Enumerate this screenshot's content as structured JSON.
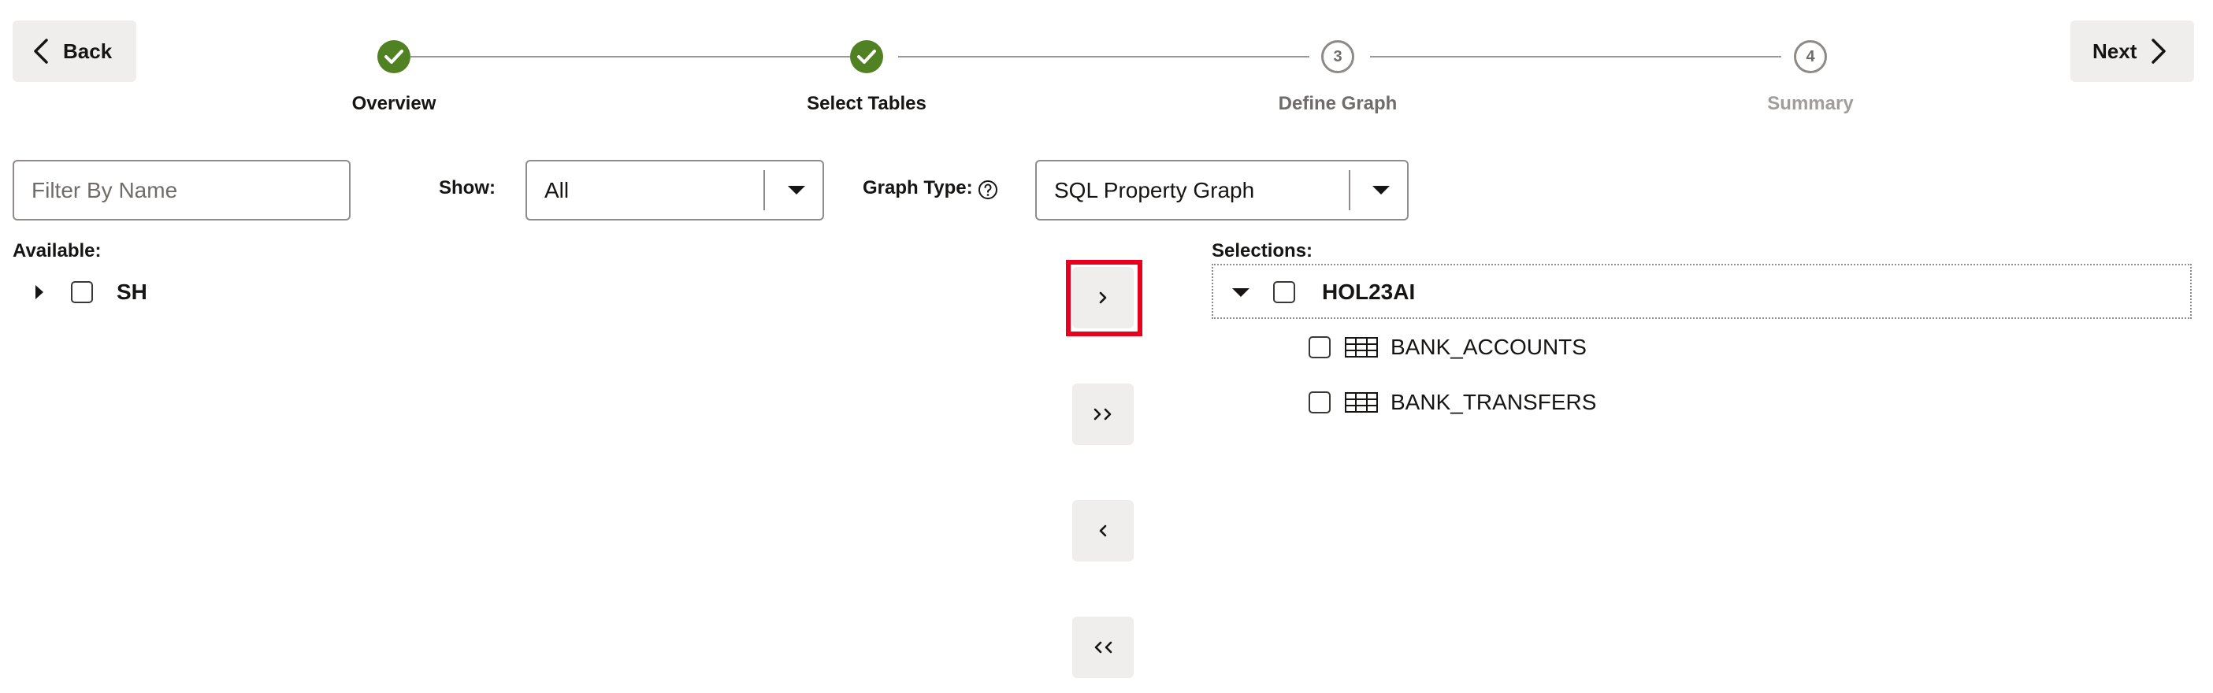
{
  "toolbar": {
    "back_label": "Back",
    "next_label": "Next"
  },
  "steps": [
    {
      "label": "Overview",
      "state": "done"
    },
    {
      "label": "Select Tables",
      "state": "done"
    },
    {
      "label": "Define Graph",
      "state": "current",
      "number": "3"
    },
    {
      "label": "Summary",
      "state": "future",
      "number": "4"
    }
  ],
  "filter": {
    "placeholder": "Filter By Name"
  },
  "show": {
    "label": "Show:",
    "value": "All"
  },
  "graph_type": {
    "label": "Graph Type:",
    "value": "SQL Property Graph"
  },
  "available": {
    "label": "Available:",
    "items": [
      {
        "name": "SH",
        "expanded": false
      }
    ]
  },
  "selections": {
    "label": "Selections:",
    "schema": {
      "name": "HOL23AI",
      "expanded": true
    },
    "tables": [
      {
        "name": "BANK_ACCOUNTS"
      },
      {
        "name": "BANK_TRANSFERS"
      }
    ]
  },
  "shuttle_buttons": [
    {
      "name": "move-selected-right",
      "glyph": ">",
      "highlighted": true
    },
    {
      "name": "move-all-right",
      "glyph": ">>"
    },
    {
      "name": "move-selected-left",
      "glyph": "<"
    },
    {
      "name": "move-all-left",
      "glyph": "<<"
    }
  ],
  "colors": {
    "step_done": "#508223",
    "highlight": "#e8001c",
    "button_bg": "#efeeec"
  }
}
